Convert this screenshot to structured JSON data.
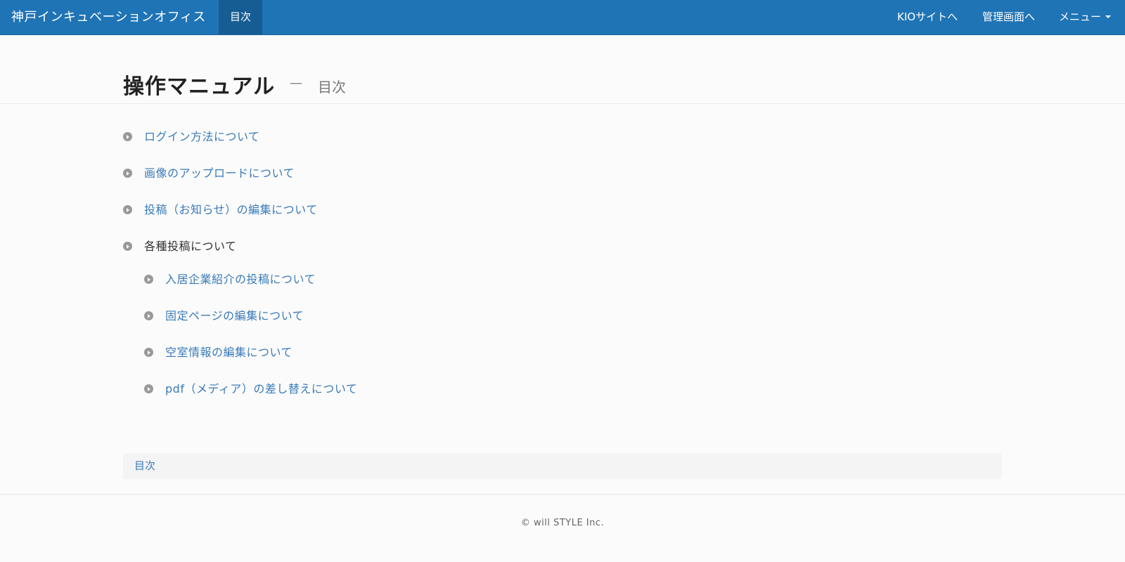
{
  "navbar": {
    "brand": "神戸インキュベーションオフィス",
    "active_item": "目次",
    "right_items": {
      "kio_site": "KIOサイトへ",
      "admin": "管理画面へ",
      "menu": "メニュー"
    },
    "colors": {
      "background": "#1f74b5",
      "active_background": "#165d93"
    }
  },
  "header": {
    "title": "操作マニュアル",
    "separator": "—",
    "subtitle": "目次"
  },
  "toc": {
    "items": [
      {
        "label": "ログイン方法について"
      },
      {
        "label": "画像のアップロードについて"
      },
      {
        "label": "投稿（お知らせ）の編集について"
      },
      {
        "label": "各種投稿について"
      }
    ],
    "subitems": [
      {
        "label": "入居企業紹介の投稿について"
      },
      {
        "label": "固定ページの編集について"
      },
      {
        "label": "空室情報の編集について"
      },
      {
        "label": "pdf（メディア）の差し替えについて"
      }
    ],
    "link_color": "#3a7bb8"
  },
  "breadcrumb": {
    "label": "目次"
  },
  "footer": {
    "copyright": "© will STYLE Inc."
  }
}
